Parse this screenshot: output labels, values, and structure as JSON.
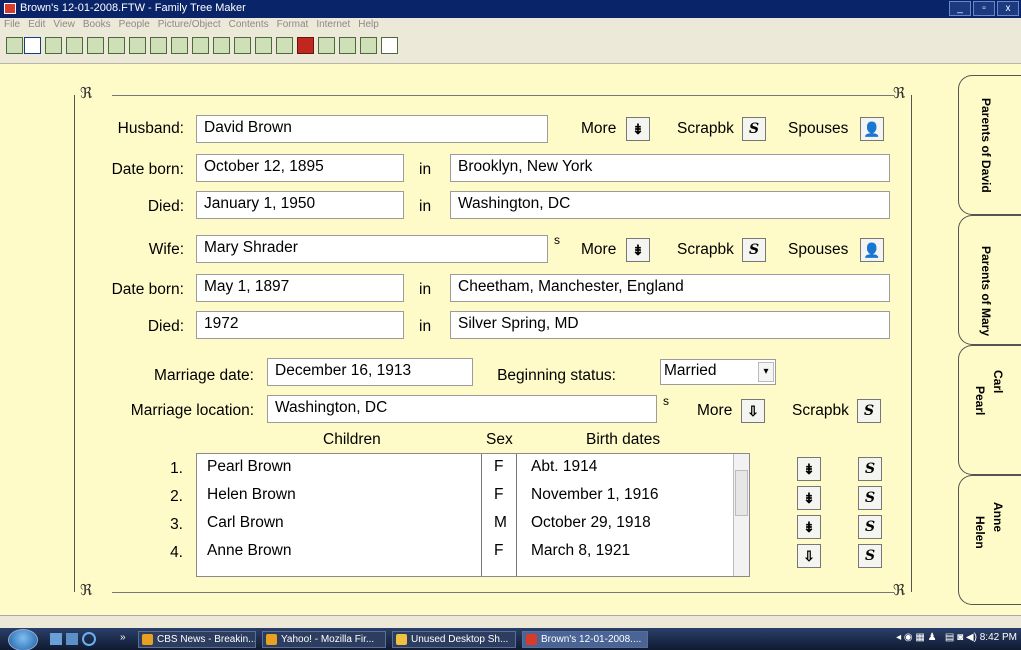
{
  "window": {
    "title": "Brown's 12-01-2008.FTW - Family Tree Maker",
    "minimize": "_",
    "maximize": "▫",
    "close": "x"
  },
  "menu": [
    "File",
    "Edit",
    "View",
    "Books",
    "People",
    "Picture/Object",
    "Contents",
    "Format",
    "Internet",
    "Help"
  ],
  "husband": {
    "label": "Husband:",
    "name": "David Brown",
    "born_label": "Date born:",
    "born": "October 12, 1895",
    "born_place": "Brooklyn, New York",
    "died_label": "Died:",
    "died": "January 1, 1950",
    "died_place": "Washington, DC"
  },
  "wife": {
    "label": "Wife:",
    "name": "Mary Shrader",
    "born_label": "Date born:",
    "born": "May 1, 1897",
    "born_place": "Cheetham, Manchester, England",
    "died_label": "Died:",
    "died": "1972",
    "died_place": "Silver Spring, MD"
  },
  "common": {
    "in": "in",
    "more": "More",
    "scrapbk": "Scrapbk",
    "spouses": "Spouses",
    "s": "s"
  },
  "marriage": {
    "date_label": "Marriage date:",
    "date": "December 16, 1913",
    "status_label": "Beginning status:",
    "status": "Married",
    "location_label": "Marriage location:",
    "location": "Washington, DC"
  },
  "children": {
    "headers": {
      "children": "Children",
      "sex": "Sex",
      "birth": "Birth dates"
    },
    "rows": [
      {
        "num": "1.",
        "name": "Pearl Brown",
        "sex": "F",
        "birth": "Abt. 1914"
      },
      {
        "num": "2.",
        "name": "Helen Brown",
        "sex": "F",
        "birth": "November 1, 1916"
      },
      {
        "num": "3.",
        "name": "Carl Brown",
        "sex": "M",
        "birth": "October 29, 1918"
      },
      {
        "num": "4.",
        "name": "Anne Brown",
        "sex": "F",
        "birth": "March 8, 1921"
      }
    ]
  },
  "tabs": {
    "parents_david": "Parents of David",
    "parents_mary": "Parents of Mary",
    "carl": "Carl",
    "pearl": "Pearl",
    "anne": "Anne",
    "helen": "Helen"
  },
  "taskbar": {
    "tasks": [
      "CBS News - Breakin...",
      "Yahoo! - Mozilla Fir...",
      "Unused Desktop Sh...",
      "Brown's 12-01-2008...."
    ],
    "clock": "8:42 PM"
  },
  "colors": {
    "background": "#fffbc8",
    "titlebar": "#0a246a"
  }
}
